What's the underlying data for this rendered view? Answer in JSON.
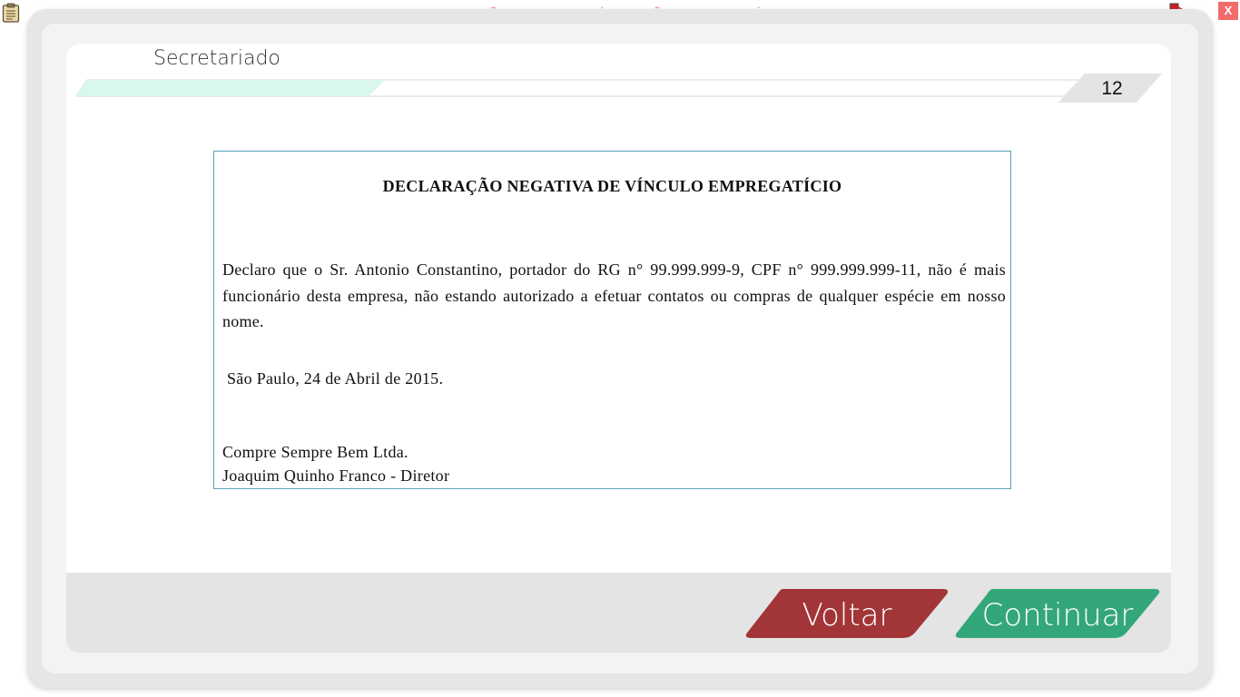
{
  "top_bar": {
    "banner": "VERSÃO PARA FUNCIONÁRIOS - NÃO COMERCIALIZÁVEL",
    "close_label": "X",
    "clipboard_icon": "clipboard-icon",
    "network_icon": "network-status-icon"
  },
  "header": {
    "section": "Secretariado",
    "page_number": "12",
    "progress_fraction": 0.3
  },
  "document": {
    "title": "DECLARAÇÃO NEGATIVA DE VÍNCULO EMPREGATÍCIO",
    "body": "Declaro que o Sr. Antonio Constantino, portador do RG n° 99.999.999-9, CPF n° 999.999.999-11, não é mais funcionário desta empresa, não estando autorizado a efetuar contatos ou compras de qualquer espécie em nosso nome.",
    "date": "São Paulo, 24 de Abril de 2015.",
    "company": "Compre Sempre Bem Ltda.",
    "signer": "Joaquim Quinho Franco - Diretor"
  },
  "footer": {
    "back_label": "Voltar",
    "continue_label": "Continuar"
  },
  "colors": {
    "back_button": "#a23538",
    "continue_button": "#34a77a",
    "progress_fill": "#d9f7ef",
    "banner_text": "#f07b7b",
    "close_button": "#f26b6b",
    "document_border": "#5a9fbd"
  }
}
